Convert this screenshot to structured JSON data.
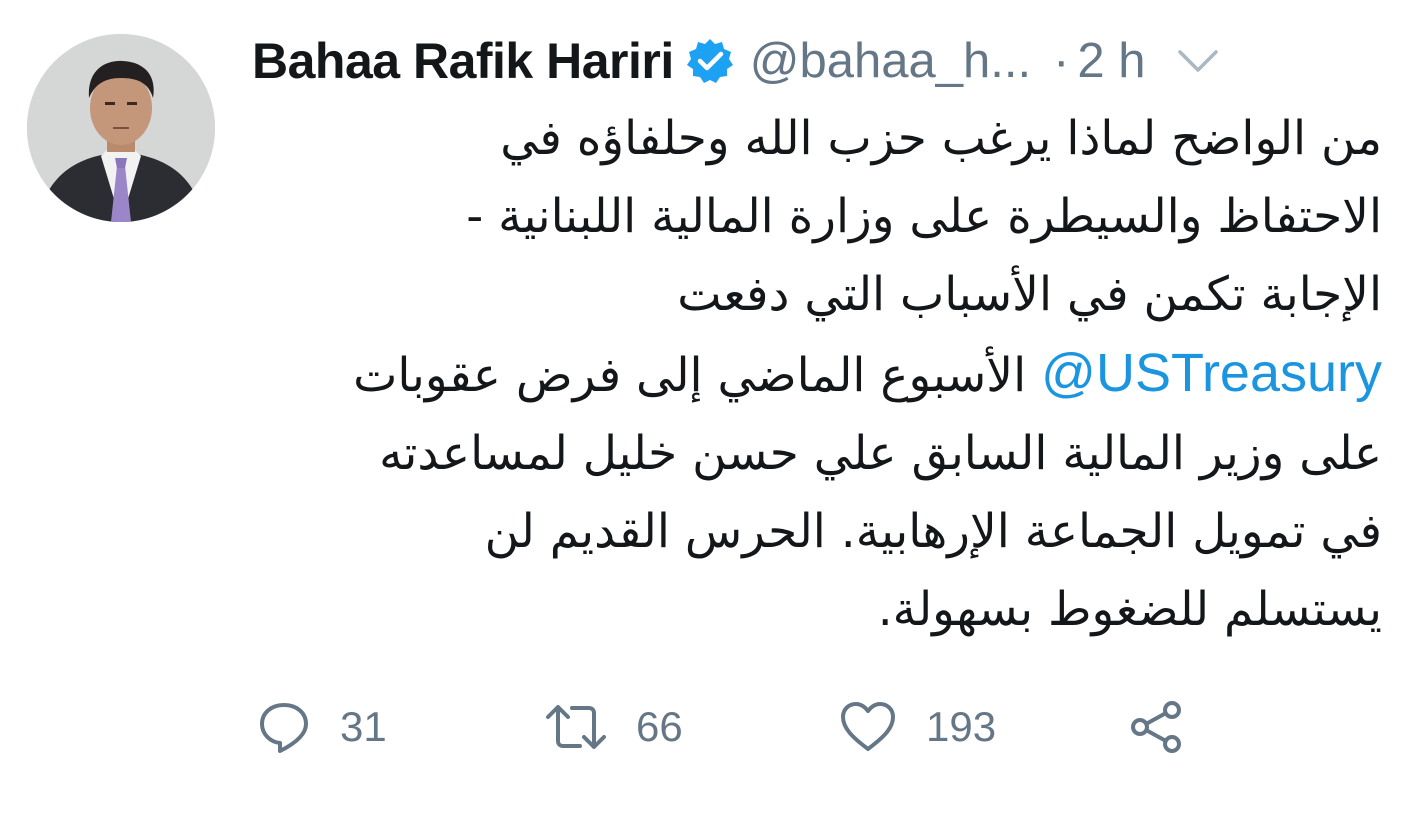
{
  "tweet": {
    "author": {
      "display_name": "Bahaa Rafik Hariri",
      "handle": "@bahaa_h...",
      "verified": true
    },
    "separator": "·",
    "time": "2 h",
    "text_lines": [
      "من الواضح لماذا يرغب حزب الله وحلفاؤه في",
      "الاحتفاظ والسيطرة على وزارة المالية اللبنانية -",
      "الإجابة تكمن في الأسباب التي دفعت",
      "الأسبوع الماضي إلى فرض عقوبات",
      "على وزير المالية السابق علي حسن خليل لمساعدته",
      "في تمويل الجماعة الإرهابية.  الحرس القديم لن",
      "يستسلم للضغوط بسهولة."
    ],
    "mention": "@USTreasury",
    "counts": {
      "replies": "31",
      "retweets": "66",
      "likes": "193"
    }
  },
  "colors": {
    "verified_badge": "#1da1f2",
    "link": "#1b95e0",
    "muted": "#657786",
    "text": "#14171a"
  },
  "icons": {
    "verified": "verified-badge-icon",
    "menu": "chevron-down-icon",
    "reply": "reply-icon",
    "retweet": "retweet-icon",
    "like": "heart-icon",
    "share": "share-icon"
  }
}
